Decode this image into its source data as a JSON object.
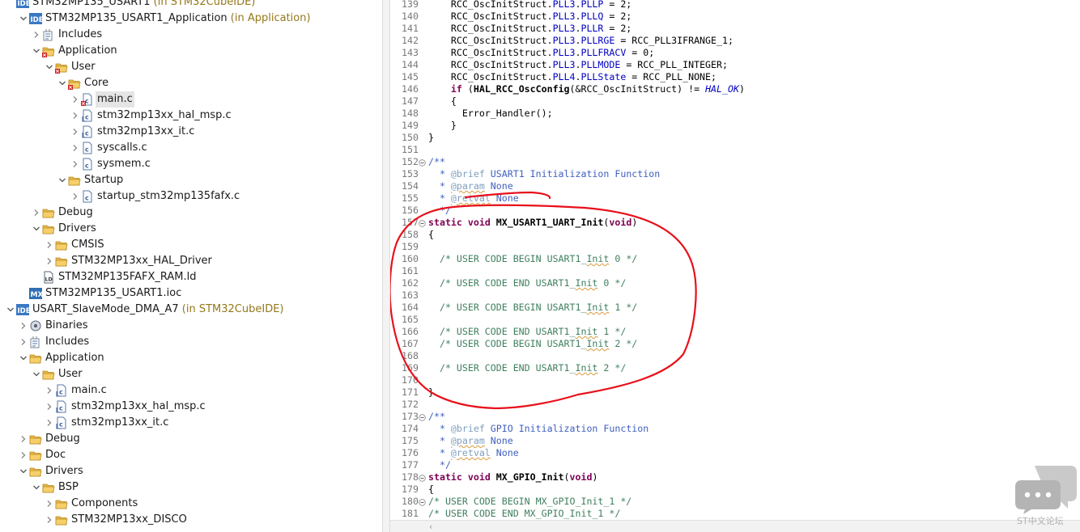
{
  "explorer": {
    "items": [
      {
        "label": "STM32MP135_USART1",
        "suffix": " (in STM32CubeIDE)",
        "icon": "ide-project-icon",
        "twisty": "none"
      },
      {
        "label": "STM32MP135_USART1_Application",
        "suffix": " (in Application)",
        "icon": "ide-project-icon",
        "twisty": "open"
      },
      {
        "label": "Includes",
        "suffix": "",
        "icon": "includes-icon",
        "twisty": "closed"
      },
      {
        "label": "Application",
        "suffix": "",
        "icon": "source-folder-error-icon",
        "twisty": "open"
      },
      {
        "label": "User",
        "suffix": "",
        "icon": "source-folder-error-icon",
        "twisty": "open"
      },
      {
        "label": "Core",
        "suffix": "",
        "icon": "source-folder-error-icon",
        "twisty": "open"
      },
      {
        "label": "main.c",
        "suffix": "",
        "icon": "c-file-error-icon",
        "twisty": "closed"
      },
      {
        "label": "stm32mp13xx_hal_msp.c",
        "suffix": "",
        "icon": "c-file-icon",
        "twisty": "closed"
      },
      {
        "label": "stm32mp13xx_it.c",
        "suffix": "",
        "icon": "c-file-icon",
        "twisty": "closed"
      },
      {
        "label": "syscalls.c",
        "suffix": "",
        "icon": "c-file-plain-icon",
        "twisty": "closed"
      },
      {
        "label": "sysmem.c",
        "suffix": "",
        "icon": "c-file-plain-icon",
        "twisty": "closed"
      },
      {
        "label": "Startup",
        "suffix": "",
        "icon": "folder-icon",
        "twisty": "open"
      },
      {
        "label": "startup_stm32mp135fafx.c",
        "suffix": "",
        "icon": "c-file-plain-icon",
        "twisty": "closed"
      },
      {
        "label": "Debug",
        "suffix": "",
        "icon": "folder-icon",
        "twisty": "closed"
      },
      {
        "label": "Drivers",
        "suffix": "",
        "icon": "folder-icon",
        "twisty": "open"
      },
      {
        "label": "CMSIS",
        "suffix": "",
        "icon": "folder-icon",
        "twisty": "closed"
      },
      {
        "label": "STM32MP13xx_HAL_Driver",
        "suffix": "",
        "icon": "folder-icon",
        "twisty": "closed"
      },
      {
        "label": "STM32MP135FAFX_RAM.ld",
        "suffix": "",
        "icon": "linker-file-icon",
        "twisty": "none"
      },
      {
        "label": "STM32MP135_USART1.ioc",
        "suffix": "",
        "icon": "mx-ioc-icon",
        "twisty": "none"
      },
      {
        "label": "USART_SlaveMode_DMA_A7",
        "suffix": " (in STM32CubeIDE)",
        "icon": "ide-project-icon",
        "twisty": "open"
      },
      {
        "label": "Binaries",
        "suffix": "",
        "icon": "binaries-icon",
        "twisty": "closed"
      },
      {
        "label": "Includes",
        "suffix": "",
        "icon": "includes-icon",
        "twisty": "closed"
      },
      {
        "label": "Application",
        "suffix": "",
        "icon": "folder-icon",
        "twisty": "open"
      },
      {
        "label": "User",
        "suffix": "",
        "icon": "folder-icon",
        "twisty": "open"
      },
      {
        "label": "main.c",
        "suffix": "",
        "icon": "c-file-icon",
        "twisty": "closed"
      },
      {
        "label": "stm32mp13xx_hal_msp.c",
        "suffix": "",
        "icon": "c-file-icon",
        "twisty": "closed"
      },
      {
        "label": "stm32mp13xx_it.c",
        "suffix": "",
        "icon": "c-file-icon",
        "twisty": "closed"
      },
      {
        "label": "Debug",
        "suffix": "",
        "icon": "folder-icon",
        "twisty": "closed"
      },
      {
        "label": "Doc",
        "suffix": "",
        "icon": "folder-icon",
        "twisty": "closed"
      },
      {
        "label": "Drivers",
        "suffix": "",
        "icon": "folder-icon",
        "twisty": "open"
      },
      {
        "label": "BSP",
        "suffix": "",
        "icon": "folder-icon",
        "twisty": "open"
      },
      {
        "label": "Components",
        "suffix": "",
        "icon": "folder-icon",
        "twisty": "closed"
      },
      {
        "label": "STM32MP13xx_DISCO",
        "suffix": "",
        "icon": "folder-icon",
        "twisty": "closed"
      }
    ],
    "selected_index": 6
  },
  "editor": {
    "lines": [
      {
        "n": "139",
        "fold": false,
        "segs": [
          [
            "p",
            "    RCC_OscInitStruct."
          ],
          [
            "f",
            "PLL3"
          ],
          [
            "p",
            "."
          ],
          [
            "f",
            "PLLP"
          ],
          [
            "p",
            " = 2;"
          ]
        ]
      },
      {
        "n": "140",
        "fold": false,
        "segs": [
          [
            "p",
            "    RCC_OscInitStruct."
          ],
          [
            "f",
            "PLL3"
          ],
          [
            "p",
            "."
          ],
          [
            "f",
            "PLLQ"
          ],
          [
            "p",
            " = 2;"
          ]
        ]
      },
      {
        "n": "141",
        "fold": false,
        "segs": [
          [
            "p",
            "    RCC_OscInitStruct."
          ],
          [
            "f",
            "PLL3"
          ],
          [
            "p",
            "."
          ],
          [
            "f",
            "PLLR"
          ],
          [
            "p",
            " = 2;"
          ]
        ]
      },
      {
        "n": "142",
        "fold": false,
        "segs": [
          [
            "p",
            "    RCC_OscInitStruct."
          ],
          [
            "f",
            "PLL3"
          ],
          [
            "p",
            "."
          ],
          [
            "f",
            "PLLRGE"
          ],
          [
            "p",
            " = RCC_PLL3IFRANGE_1;"
          ]
        ]
      },
      {
        "n": "143",
        "fold": false,
        "segs": [
          [
            "p",
            "    RCC_OscInitStruct."
          ],
          [
            "f",
            "PLL3"
          ],
          [
            "p",
            "."
          ],
          [
            "f",
            "PLLFRACV"
          ],
          [
            "p",
            " = 0;"
          ]
        ]
      },
      {
        "n": "144",
        "fold": false,
        "segs": [
          [
            "p",
            "    RCC_OscInitStruct."
          ],
          [
            "f",
            "PLL3"
          ],
          [
            "p",
            "."
          ],
          [
            "f",
            "PLLMODE"
          ],
          [
            "p",
            " = RCC_PLL_INTEGER;"
          ]
        ]
      },
      {
        "n": "145",
        "fold": false,
        "segs": [
          [
            "p",
            "    RCC_OscInitStruct."
          ],
          [
            "f",
            "PLL4"
          ],
          [
            "p",
            "."
          ],
          [
            "f",
            "PLLState"
          ],
          [
            "p",
            " = RCC_PLL_NONE;"
          ]
        ]
      },
      {
        "n": "146",
        "fold": false,
        "segs": [
          [
            "p",
            "    "
          ],
          [
            "k",
            "if"
          ],
          [
            "p",
            " ("
          ],
          [
            "b",
            "HAL_RCC_OscConfig"
          ],
          [
            "p",
            "(&RCC_OscInitStruct) != "
          ],
          [
            "i",
            "HAL_OK"
          ],
          [
            "p",
            ")"
          ]
        ]
      },
      {
        "n": "147",
        "fold": false,
        "segs": [
          [
            "p",
            "    {"
          ]
        ]
      },
      {
        "n": "148",
        "fold": false,
        "segs": [
          [
            "p",
            "      Error_Handler();"
          ]
        ]
      },
      {
        "n": "149",
        "fold": false,
        "segs": [
          [
            "p",
            "    }"
          ]
        ]
      },
      {
        "n": "150",
        "fold": false,
        "segs": [
          [
            "p",
            "}"
          ]
        ]
      },
      {
        "n": "151",
        "fold": false,
        "segs": []
      },
      {
        "n": "152",
        "fold": true,
        "segs": [
          [
            "j",
            "/**"
          ]
        ]
      },
      {
        "n": "153",
        "fold": false,
        "segs": [
          [
            "j",
            "  * "
          ],
          [
            "t",
            "@brief"
          ],
          [
            "j",
            " USART1 Initialization Function"
          ]
        ]
      },
      {
        "n": "154",
        "fold": false,
        "segs": [
          [
            "j",
            "  * "
          ],
          [
            "tu",
            "@param"
          ],
          [
            "j",
            " None"
          ]
        ]
      },
      {
        "n": "155",
        "fold": false,
        "segs": [
          [
            "j",
            "  * "
          ],
          [
            "tu",
            "@retval"
          ],
          [
            "j",
            " None"
          ]
        ]
      },
      {
        "n": "156",
        "fold": false,
        "segs": [
          [
            "j",
            "  */"
          ]
        ]
      },
      {
        "n": "157",
        "fold": true,
        "segs": [
          [
            "k",
            "static"
          ],
          [
            "p",
            " "
          ],
          [
            "k",
            "void"
          ],
          [
            "p",
            " "
          ],
          [
            "b",
            "MX_USART1_UART_Init"
          ],
          [
            "p",
            "("
          ],
          [
            "k",
            "void"
          ],
          [
            "p",
            ")"
          ]
        ]
      },
      {
        "n": "158",
        "fold": false,
        "segs": [
          [
            "p",
            "{"
          ]
        ]
      },
      {
        "n": "159",
        "fold": false,
        "segs": []
      },
      {
        "n": "160",
        "fold": false,
        "segs": [
          [
            "c",
            "  /* USER CODE BEGIN USART1_"
          ],
          [
            "cu",
            "Init"
          ],
          [
            "c",
            " 0 */"
          ]
        ]
      },
      {
        "n": "161",
        "fold": false,
        "segs": []
      },
      {
        "n": "162",
        "fold": false,
        "segs": [
          [
            "c",
            "  /* USER CODE END USART1_"
          ],
          [
            "cu",
            "Init"
          ],
          [
            "c",
            " 0 */"
          ]
        ]
      },
      {
        "n": "163",
        "fold": false,
        "segs": []
      },
      {
        "n": "164",
        "fold": false,
        "segs": [
          [
            "c",
            "  /* USER CODE BEGIN USART1_"
          ],
          [
            "cu",
            "Init"
          ],
          [
            "c",
            " 1 */"
          ]
        ]
      },
      {
        "n": "165",
        "fold": false,
        "segs": []
      },
      {
        "n": "166",
        "fold": false,
        "segs": [
          [
            "c",
            "  /* USER CODE END USART1_"
          ],
          [
            "cu",
            "Init"
          ],
          [
            "c",
            " 1 */"
          ]
        ]
      },
      {
        "n": "167",
        "fold": false,
        "segs": [
          [
            "c",
            "  /* USER CODE BEGIN USART1_"
          ],
          [
            "cu",
            "Init"
          ],
          [
            "c",
            " 2 */"
          ]
        ]
      },
      {
        "n": "168",
        "fold": false,
        "segs": []
      },
      {
        "n": "169",
        "fold": false,
        "segs": [
          [
            "c",
            "  /* USER CODE END USART1_"
          ],
          [
            "cu",
            "Init"
          ],
          [
            "c",
            " 2 */"
          ]
        ]
      },
      {
        "n": "170",
        "fold": false,
        "segs": []
      },
      {
        "n": "171",
        "fold": false,
        "segs": [
          [
            "p",
            "}"
          ]
        ]
      },
      {
        "n": "172",
        "fold": false,
        "segs": []
      },
      {
        "n": "173",
        "fold": true,
        "segs": [
          [
            "j",
            "/**"
          ]
        ]
      },
      {
        "n": "174",
        "fold": false,
        "segs": [
          [
            "j",
            "  * "
          ],
          [
            "t",
            "@brief"
          ],
          [
            "j",
            " GPIO Initialization Function"
          ]
        ]
      },
      {
        "n": "175",
        "fold": false,
        "segs": [
          [
            "j",
            "  * "
          ],
          [
            "tu",
            "@param"
          ],
          [
            "j",
            " None"
          ]
        ]
      },
      {
        "n": "176",
        "fold": false,
        "segs": [
          [
            "j",
            "  * "
          ],
          [
            "tu",
            "@retval"
          ],
          [
            "j",
            " None"
          ]
        ]
      },
      {
        "n": "177",
        "fold": false,
        "segs": [
          [
            "j",
            "  */"
          ]
        ]
      },
      {
        "n": "178",
        "fold": true,
        "segs": [
          [
            "k",
            "static"
          ],
          [
            "p",
            " "
          ],
          [
            "k",
            "void"
          ],
          [
            "p",
            " "
          ],
          [
            "b",
            "MX_GPIO_Init"
          ],
          [
            "p",
            "("
          ],
          [
            "k",
            "void"
          ],
          [
            "p",
            ")"
          ]
        ]
      },
      {
        "n": "179",
        "fold": false,
        "segs": [
          [
            "p",
            "{"
          ]
        ]
      },
      {
        "n": "180",
        "fold": true,
        "segs": [
          [
            "c",
            "/* USER CODE BEGIN MX_GPIO_Init_1 */"
          ]
        ]
      },
      {
        "n": "181",
        "fold": false,
        "segs": [
          [
            "c",
            "/* USER CODE END MX_GPIO_Init_1 */"
          ]
        ]
      }
    ]
  },
  "watermark": {
    "text": "ST中文论坛"
  },
  "colors": {
    "annotation": "#e8101a",
    "keyword": "#7f0055",
    "field": "#0000c0",
    "comment": "#3f7f5f",
    "javadoc": "#3f5fbf",
    "javadoc_tag": "#7f9fbf",
    "line_number": "#787878",
    "folder": "#e9b84a",
    "error_badge": "#d22020"
  }
}
